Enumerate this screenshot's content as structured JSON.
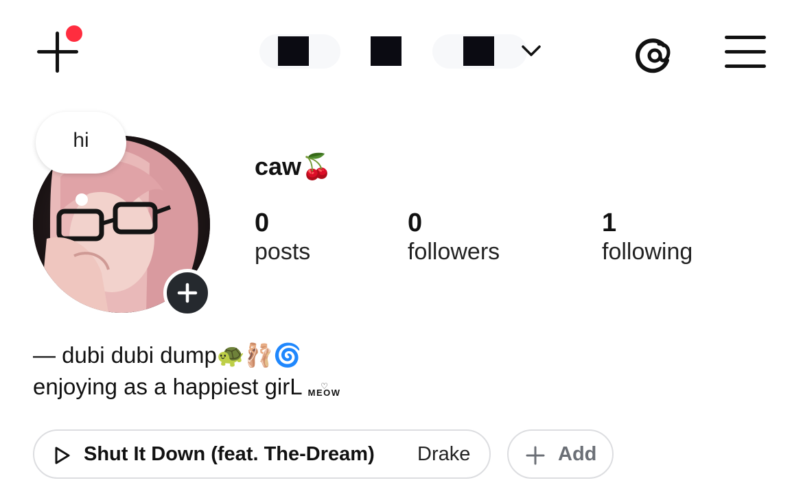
{
  "header": {
    "new_post_icon": "plus-icon",
    "notification_color": "#ff2d3f",
    "account_switcher_icon": "chevron-down-icon",
    "threads_icon": "threads-icon",
    "menu_icon": "hamburger-menu-icon"
  },
  "profile": {
    "note": "hi",
    "username": "caw🍒",
    "add_story_icon": "plus-icon",
    "stats": [
      {
        "value": "0",
        "label": "posts"
      },
      {
        "value": "0",
        "label": "followers"
      },
      {
        "value": "1",
        "label": "following"
      }
    ],
    "bio": {
      "line1": "— dubi dubi dump🐢🩰🌀",
      "line2": "enjoying as a happiest girL",
      "sticker_heart": "♡",
      "sticker_word": "MEOW"
    }
  },
  "music": {
    "icon": "play-icon",
    "song": "Shut It Down (feat. The-Dream)",
    "artist": "Drake"
  },
  "add_button": {
    "icon": "plus-icon",
    "label": "Add"
  },
  "colors": {
    "text": "#111111",
    "chip_border": "#dcdde0",
    "add_label": "#6b6f76",
    "story_button": "#25292e"
  }
}
